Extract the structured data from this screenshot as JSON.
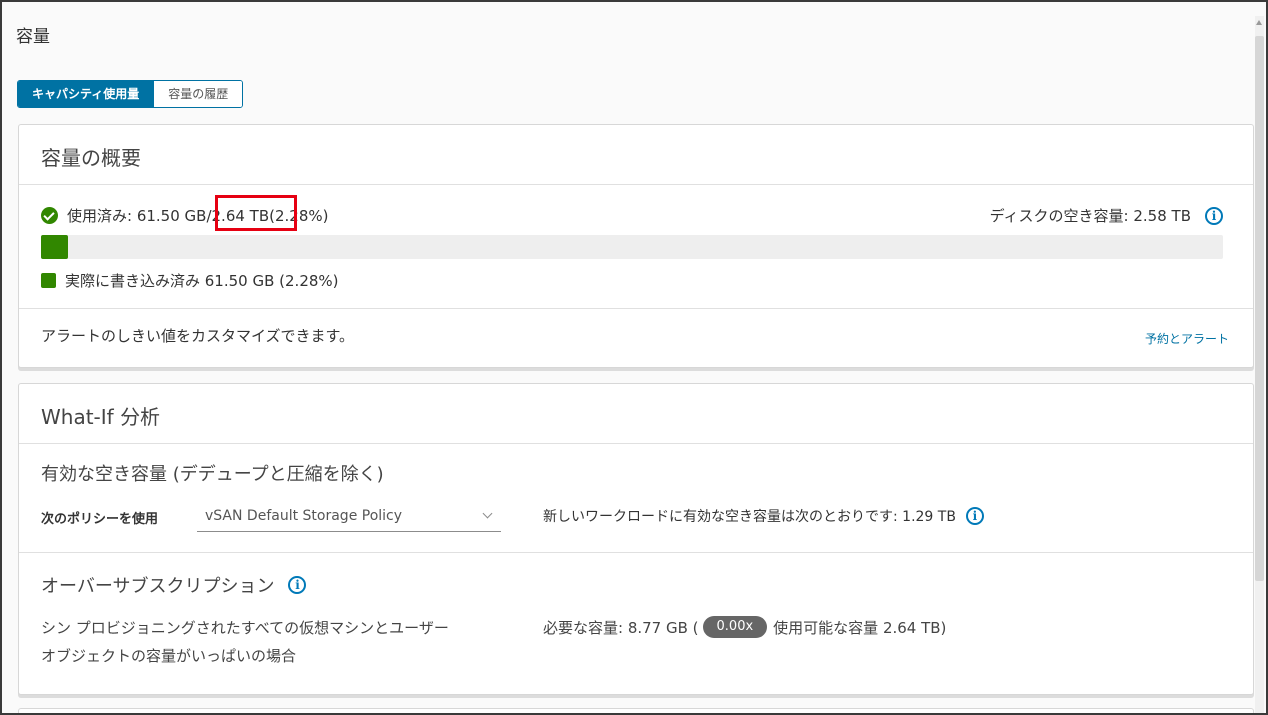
{
  "page": {
    "title": "容量"
  },
  "tabs": [
    {
      "label": "キャパシティ使用量",
      "active": true
    },
    {
      "label": "容量の履歴",
      "active": false
    }
  ],
  "overview": {
    "title": "容量の概要",
    "used_prefix": "使用済み: 61.50 GB",
    "used_total": "/2.64 TB",
    "used_percent": "(2.28%)",
    "free_label": "ディスクの空き容量: 2.58 TB",
    "usage_fraction": 0.0228,
    "legend_label": "実際に書き込み済み 61.50 GB (2.28%)",
    "alert_text": "アラートのしきい値をカスタマイズできます。",
    "alert_link": "予約とアラート"
  },
  "whatif": {
    "title": "What-If 分析",
    "effective_title": "有効な空き容量 (デデュープと圧縮を除く)",
    "policy_label": "次のポリシーを使用",
    "policy_selected": "vSAN Default Storage Policy",
    "workload_text": "新しいワークロードに有効な空き容量は次のとおりです: 1.29 TB",
    "oversub_title": "オーバーサブスクリプション",
    "oversub_desc_line1": "シン プロビジョニングされたすべての仮想マシンとユーザー",
    "oversub_desc_line2": "オブジェクトの容量がいっぱいの場合",
    "required_prefix": "必要な容量: 8.77 GB (",
    "ratio": "0.00x",
    "required_suffix": "使用可能な容量 2.64 TB)"
  },
  "colors": {
    "accent": "#0072a3",
    "used_green": "#318700",
    "highlight_red": "#e60012",
    "badge_gray": "#666666"
  },
  "icons": {
    "status": "check-circle-icon",
    "info": "info-circle-icon",
    "dropdown": "chevron-down-icon"
  }
}
